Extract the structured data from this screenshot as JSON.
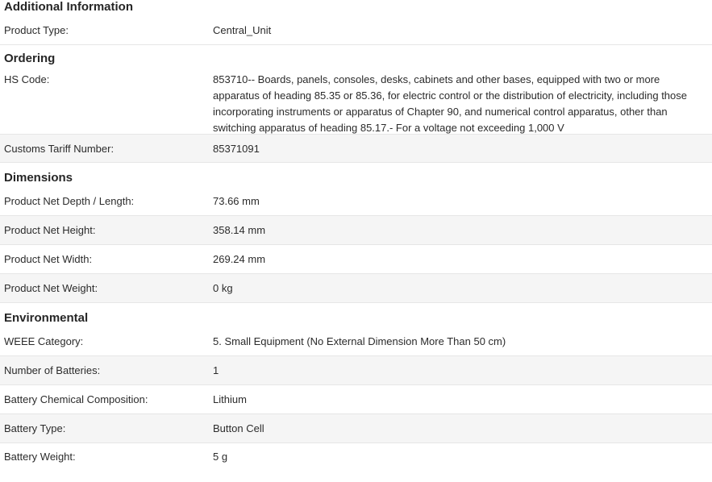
{
  "sections": {
    "additional": {
      "title": "Additional Information",
      "rows": [
        {
          "label": "Product Type:",
          "value": "Central_Unit"
        }
      ]
    },
    "ordering": {
      "title": "Ordering",
      "rows": [
        {
          "label": "HS Code:",
          "value": "853710-- Boards, panels, consoles, desks, cabinets and other bases, equipped with two or more apparatus of heading 85.35 or 85.36, for electric control or the distribution of electricity, including those incorporating instruments or apparatus of Chapter 90, and numerical control apparatus, other than switching apparatus of heading 85.17.- For a voltage not exceeding 1,000 V"
        },
        {
          "label": "Customs Tariff Number:",
          "value": "85371091"
        }
      ]
    },
    "dimensions": {
      "title": "Dimensions",
      "rows": [
        {
          "label": "Product Net Depth / Length:",
          "value": "73.66 mm"
        },
        {
          "label": "Product Net Height:",
          "value": "358.14 mm"
        },
        {
          "label": "Product Net Width:",
          "value": "269.24 mm"
        },
        {
          "label": "Product Net Weight:",
          "value": "0 kg"
        }
      ]
    },
    "environmental": {
      "title": "Environmental",
      "rows": [
        {
          "label": "WEEE Category:",
          "value": "5. Small Equipment (No External Dimension More Than 50 cm)"
        },
        {
          "label": "Number of Batteries:",
          "value": "1"
        },
        {
          "label": "Battery Chemical Composition:",
          "value": "Lithium"
        },
        {
          "label": "Battery Type:",
          "value": "Button Cell"
        },
        {
          "label": "Battery Weight:",
          "value": "5 g"
        }
      ]
    }
  }
}
